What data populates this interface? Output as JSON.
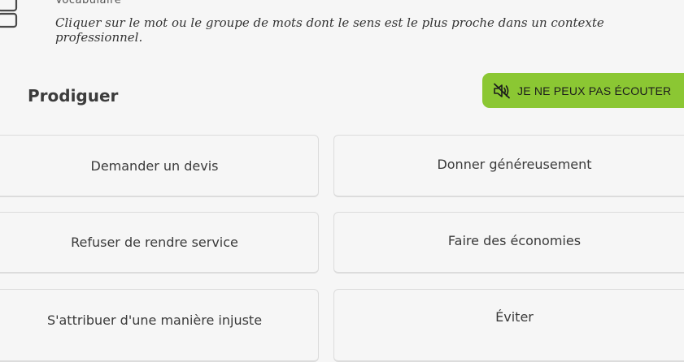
{
  "header": {
    "category": "Vocabulaire",
    "instruction": "Cliquer sur le mot ou le groupe de mots dont le sens est le plus proche dans un contexte professionnel."
  },
  "prompt": {
    "word": "Prodiguer"
  },
  "audio_button": {
    "label": "JE NE PEUX PAS ÉCOUTER",
    "icon": "speaker-muted-icon",
    "color": "#8bc733"
  },
  "options": [
    "Demander un devis",
    "Donner généreusement",
    "Refuser de rendre service",
    "Faire des économies",
    "S'attribuer d'une manière injuste",
    "Éviter"
  ]
}
